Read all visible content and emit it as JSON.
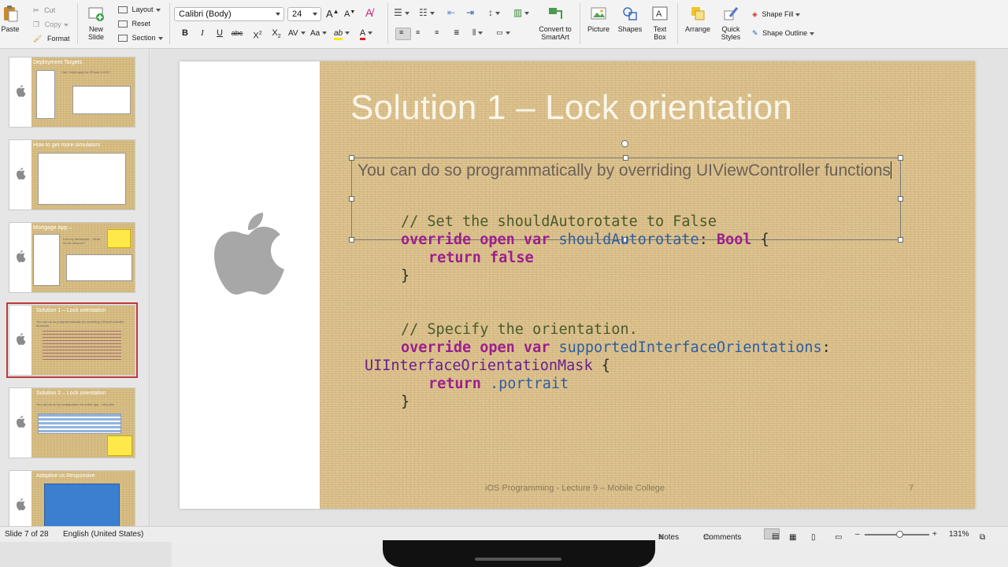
{
  "ribbon": {
    "paste": "Paste",
    "cut": "Cut",
    "copy": "Copy",
    "format": "Format",
    "new_slide": [
      "New",
      "Slide"
    ],
    "layout": "Layout",
    "reset": "Reset",
    "section": "Section",
    "font_name": "Calibri (Body)",
    "font_size": "24",
    "convert": [
      "Convert to",
      "SmartArt"
    ],
    "picture": "Picture",
    "shapes": "Shapes",
    "textbox": [
      "Text",
      "Box"
    ],
    "arrange": "Arrange",
    "quick_styles": [
      "Quick",
      "Styles"
    ],
    "shape_fill": "Shape Fill",
    "shape_outline": "Shape Outline",
    "bold": "B",
    "italic": "I",
    "underline": "U",
    "strike": "abc",
    "superscript": "X",
    "subscript": "X",
    "exp2": "2",
    "spacing": "AV",
    "case": "Aa",
    "grow": "A",
    "shrink": "A",
    "highlight": "ab",
    "font_color": "A"
  },
  "thumbnails": [
    {
      "title": "Deployment Targets",
      "sub": "Can I build apps for iPhone & iOS?"
    },
    {
      "title": "How to get more simulators",
      "sub": ""
    },
    {
      "title": "Mortgage App –",
      "sub": "Let’s try landscape – What do we observe?"
    },
    {
      "title": "Solution 1 – Lock orientation",
      "sub": "You can do so programmatically by overriding UIViewController functions"
    },
    {
      "title": "Solution 2 – Lock orientation",
      "sub": "You can do so by configuration for entire app – Info.plist"
    },
    {
      "title": "Adaptive vs Responsive",
      "sub": ""
    }
  ],
  "slide": {
    "title": "Solution 1 – Lock orientation",
    "body": "You can do so programmatically by overriding UIViewController functions",
    "footer": "iOS Programming - Lecture 9 – Mobile College",
    "page": "7",
    "code": {
      "l1": "// Set the shouldAutorotate to False",
      "l2_kw": "override open var ",
      "l2_prop": "shouldAutorotate",
      "l2_rest": ": ",
      "l2_type": "Bool",
      "l2_end": " {",
      "l3_kw": "return false",
      "l4": "}",
      "l5": "// Specify the orientation.",
      "l6_kw": "override open var ",
      "l6_prop": "supportedInterfaceOrientations",
      "l6_rest": ":",
      "l7_type": "UIInterfaceOrientationMask",
      "l7_end": " {",
      "l8_kw": "return",
      "l8_rest": " .portrait",
      "l9": "}"
    }
  },
  "status": {
    "slide_info": "Slide 7 of 28",
    "language": "English (United States)",
    "notes": "Notes",
    "comments": "Comments",
    "zoom_minus": "–",
    "zoom_plus": "+",
    "zoom": "131%"
  },
  "colors": {
    "selection": "#c0383d",
    "title_text": "#fbf6ea",
    "keyword": "#9b1f8e",
    "type": "#2b4fa8"
  }
}
